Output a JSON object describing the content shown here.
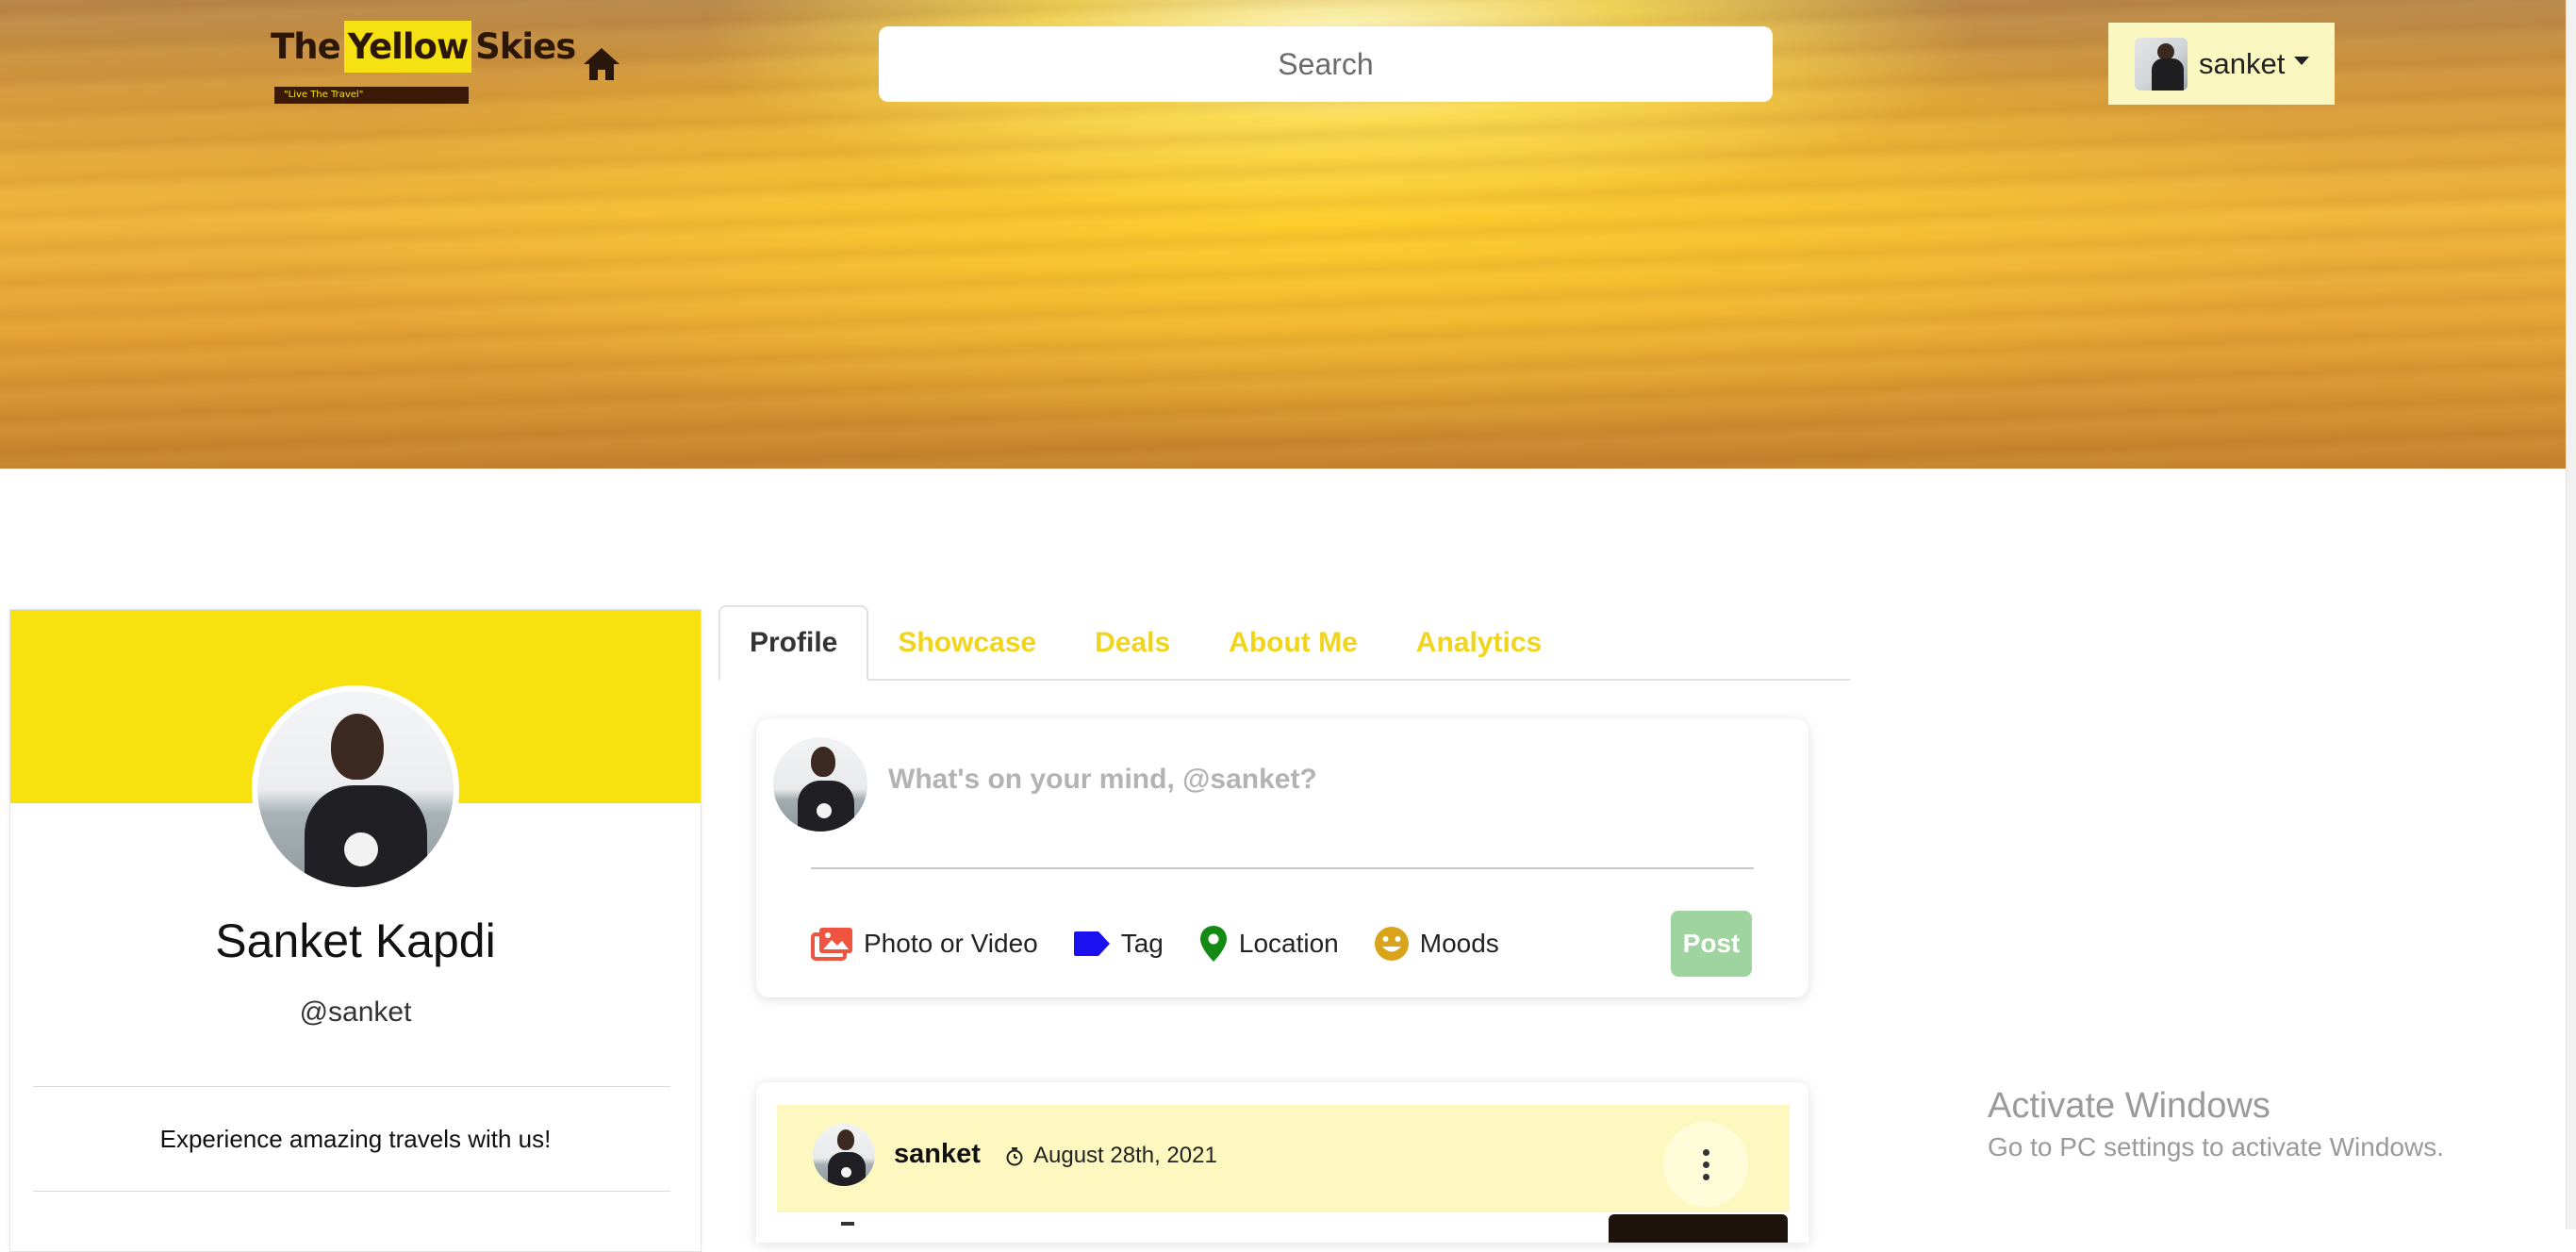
{
  "header": {
    "logo": {
      "word1": "The",
      "word2": "Yellow",
      "word3": "Skies",
      "tagline": "\"Live The Travel\"",
      "highlight_color": "#f6e112"
    },
    "home_icon": "home-icon",
    "search": {
      "placeholder": "Search",
      "value": ""
    },
    "user_menu": {
      "username": "sanket",
      "icon": "caret-down-icon"
    }
  },
  "profile_card": {
    "full_name": "Sanket Kapdi",
    "handle": "@sanket",
    "bio": "Experience amazing travels with us!",
    "cover_color": "#f7e20f"
  },
  "tabs": [
    {
      "label": "Profile",
      "active": true
    },
    {
      "label": "Showcase",
      "active": false
    },
    {
      "label": "Deals",
      "active": false
    },
    {
      "label": "About Me",
      "active": false
    },
    {
      "label": "Analytics",
      "active": false
    }
  ],
  "composer": {
    "prompt": "What's on your mind, @sanket?",
    "actions": [
      {
        "label": "Photo or Video",
        "icon": "photo-icon",
        "color": "#f0533f"
      },
      {
        "label": "Tag",
        "icon": "tag-icon",
        "color": "#1b10f0"
      },
      {
        "label": "Location",
        "icon": "location-pin-icon",
        "color": "#138a13"
      },
      {
        "label": "Moods",
        "icon": "smiley-icon",
        "color": "#d9a31a"
      }
    ],
    "post_label": "Post",
    "post_color": "#9fd4a0"
  },
  "post": {
    "username": "sanket",
    "date": "August 28th, 2021",
    "icon": "clock-icon",
    "menu_icon": "more-vertical-icon"
  },
  "watermark": {
    "title": "Activate Windows",
    "subtitle": "Go to PC settings to activate Windows."
  },
  "colors": {
    "accent_yellow": "#f0d51b",
    "header_menu_bg": "#fbf7c0"
  }
}
